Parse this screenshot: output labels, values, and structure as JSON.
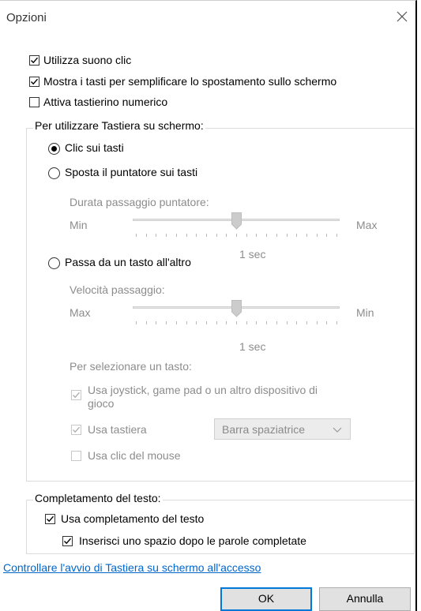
{
  "window": {
    "title": "Opzioni"
  },
  "options": {
    "click_sound": {
      "label": "Utilizza suono clic",
      "checked": true
    },
    "move_keys": {
      "label": "Mostra i tasti per semplificare lo spostamento sullo schermo",
      "checked": true
    },
    "numpad": {
      "label": "Attiva tastierino numerico",
      "checked": false
    }
  },
  "usage_group": {
    "legend": "Per utilizzare Tastiera su schermo:",
    "click_keys": {
      "label": "Clic sui tasti",
      "selected": true
    },
    "hover": {
      "label": "Sposta il puntatore sui tasti",
      "selected": false,
      "duration_label": "Durata passaggio puntatore:",
      "min_label": "Min",
      "max_label": "Max",
      "value_label": "1 sec",
      "slider_fraction": 0.5
    },
    "scan": {
      "label": "Passa da un tasto all'altro",
      "selected": false,
      "speed_label": "Velocità passaggio:",
      "max_label": "Max",
      "min_label": "Min",
      "value_label": "1 sec",
      "slider_fraction": 0.5
    },
    "select_key_label": "Per selezionare un tasto:",
    "joystick": {
      "label_line1": "Usa joystick, game pad o un altro dispositivo di",
      "label_line2": "gioco",
      "checked": true
    },
    "keyboard": {
      "label": "Usa tastiera",
      "checked": true,
      "combo_value": "Barra spaziatrice"
    },
    "mouse": {
      "label": "Usa clic del mouse",
      "checked": false
    }
  },
  "completion_group": {
    "legend": "Completamento del testo:",
    "use_completion": {
      "label": "Usa completamento del testo",
      "checked": true
    },
    "insert_space": {
      "label": "Inserisci uno spazio dopo le parole completate",
      "checked": true
    }
  },
  "link": {
    "text": "Controllare l'avvio di Tastiera su schermo all'accesso"
  },
  "buttons": {
    "ok": "OK",
    "cancel": "Annulla"
  },
  "colors": {
    "link": "#0066cc",
    "default_button_border": "#0078d7",
    "disabled_text": "#8c8c8c"
  }
}
